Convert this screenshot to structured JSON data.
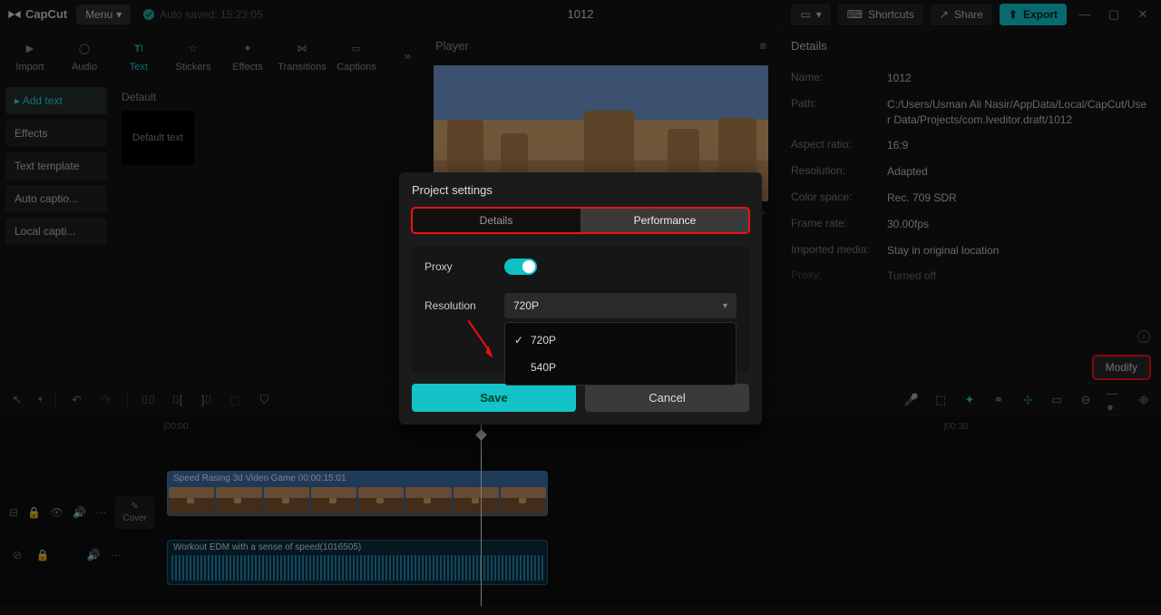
{
  "top": {
    "logo": "CapCut",
    "menu": "Menu",
    "autosaved": "Auto saved: 15:23:05",
    "title": "1012",
    "shortcuts": "Shortcuts",
    "share": "Share",
    "export": "Export"
  },
  "tabs": {
    "import": "Import",
    "audio": "Audio",
    "text": "Text",
    "stickers": "Stickers",
    "effects": "Effects",
    "transitions": "Transitions",
    "captions": "Captions"
  },
  "textSide": {
    "add": "Add text",
    "effects": "Effects",
    "template": "Text template",
    "autocap": "Auto captio...",
    "localcap": "Local capti..."
  },
  "asset": {
    "heading": "Default",
    "card": "Default text"
  },
  "player": {
    "label": "Player"
  },
  "details": {
    "heading": "Details",
    "rows": {
      "name_k": "Name:",
      "name_v": "1012",
      "path_k": "Path:",
      "path_v": "C:/Users/Usman Ali Nasir/AppData/Local/CapCut/User Data/Projects/com.lveditor.draft/1012",
      "aspect_k": "Aspect ratio:",
      "aspect_v": "16:9",
      "res_k": "Resolution:",
      "res_v": "Adapted",
      "cs_k": "Color space:",
      "cs_v": "Rec. 709 SDR",
      "fr_k": "Frame rate:",
      "fr_v": "30.00fps",
      "im_k": "Imported media:",
      "im_v": "Stay in original location",
      "proxy_k": "Proxy:",
      "proxy_v": "Turned off"
    },
    "modify": "Modify"
  },
  "modal": {
    "title": "Project settings",
    "tab1": "Details",
    "tab2": "Performance",
    "proxy": "Proxy",
    "resolution": "Resolution",
    "selected": "720P",
    "opt1": "720P",
    "opt2": "540P",
    "save": "Save",
    "cancel": "Cancel"
  },
  "timeline": {
    "t0": "|00:00",
    "t1": "|00:30",
    "cover": "Cover",
    "clip_video": "Speed Rasing 3d Video Game   00:00:15:01",
    "clip_audio": "Workout EDM with a sense of speed(1016505)"
  }
}
